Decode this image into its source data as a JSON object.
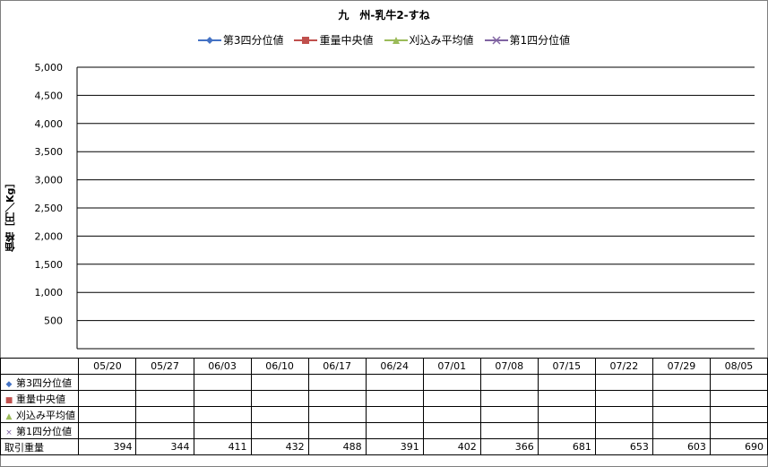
{
  "chart_data": {
    "type": "line",
    "title": "九　州-乳牛2-すね",
    "ylabel": "価格［円／Kg］",
    "xlabel": "",
    "ylim": [
      0,
      5000
    ],
    "yticks": [
      500,
      1000,
      1500,
      2000,
      2500,
      3000,
      3500,
      4000,
      4500,
      5000
    ],
    "ytick_labels": [
      "500",
      "1,000",
      "1,500",
      "2,000",
      "2,500",
      "3,000",
      "3,500",
      "4,000",
      "4,500",
      "5,000"
    ],
    "grid": true,
    "legend_position": "top",
    "categories": [
      "05/20",
      "05/27",
      "06/03",
      "06/10",
      "06/17",
      "06/24",
      "07/01",
      "07/08",
      "07/15",
      "07/22",
      "07/29",
      "08/05"
    ],
    "series": [
      {
        "name": "第3四分位値",
        "color": "#4472c4",
        "marker": "diamond",
        "values": [
          null,
          null,
          null,
          null,
          null,
          null,
          null,
          null,
          null,
          null,
          null,
          null
        ]
      },
      {
        "name": "重量中央値",
        "color": "#c0504d",
        "marker": "square",
        "values": [
          null,
          null,
          null,
          null,
          null,
          null,
          null,
          null,
          null,
          null,
          null,
          null
        ]
      },
      {
        "name": "刈込み平均値",
        "color": "#9bbb59",
        "marker": "triangle",
        "values": [
          null,
          null,
          null,
          null,
          null,
          null,
          null,
          null,
          null,
          null,
          null,
          null
        ]
      },
      {
        "name": "第1四分位値",
        "color": "#8064a2",
        "marker": "x",
        "values": [
          null,
          null,
          null,
          null,
          null,
          null,
          null,
          null,
          null,
          null,
          null,
          null
        ]
      }
    ],
    "table": {
      "volume_label": "取引重量",
      "volume_values": [
        394,
        344,
        411,
        432,
        488,
        391,
        402,
        366,
        681,
        653,
        603,
        690
      ]
    }
  }
}
